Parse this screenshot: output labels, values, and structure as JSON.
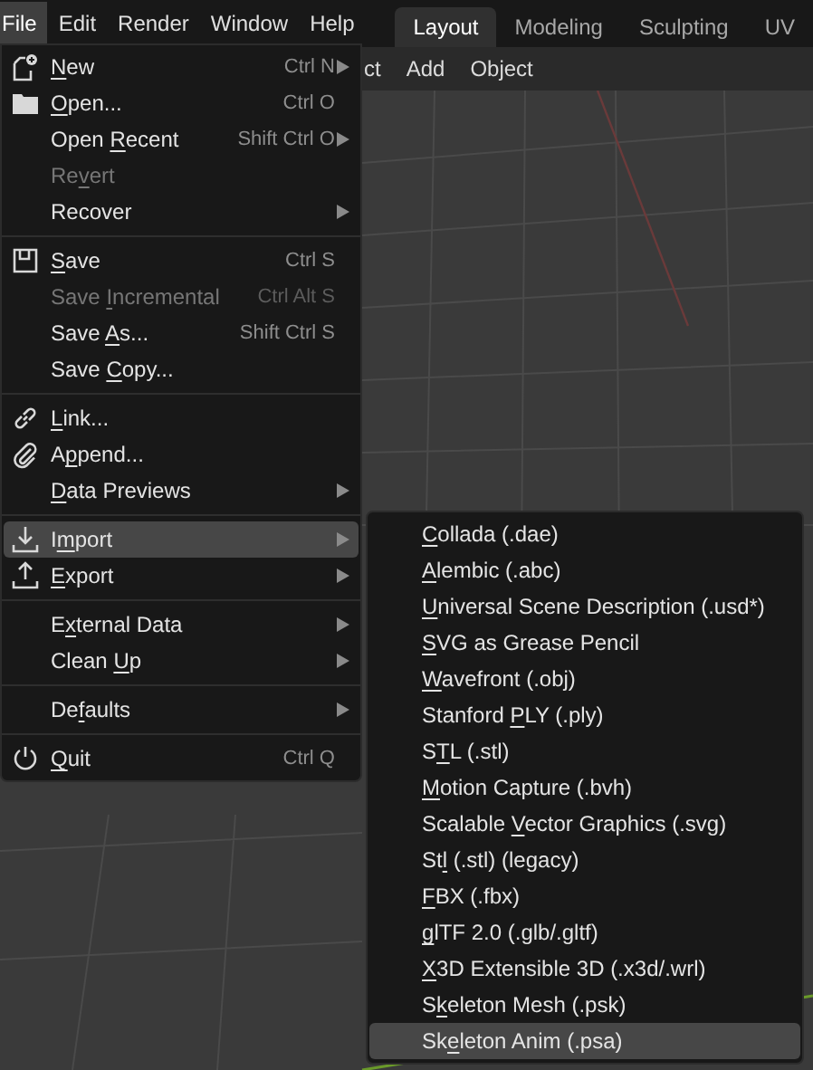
{
  "menubar": {
    "menus": [
      {
        "label": "File",
        "selected": true
      },
      {
        "label": "Edit",
        "selected": false
      },
      {
        "label": "Render",
        "selected": false
      },
      {
        "label": "Window",
        "selected": false
      },
      {
        "label": "Help",
        "selected": false
      }
    ],
    "workspaces": [
      {
        "label": "Layout",
        "selected": true
      },
      {
        "label": "Modeling",
        "selected": false
      },
      {
        "label": "Sculpting",
        "selected": false
      },
      {
        "label": "UV",
        "selected": false
      }
    ]
  },
  "viewport_header": {
    "items": [
      "ct",
      "Add",
      "Object"
    ]
  },
  "file_menu": {
    "sections": [
      [
        {
          "key": "N",
          "post": "ew",
          "shortcut": "Ctrl N",
          "submenu": true,
          "disabled": false,
          "selected": false
        },
        {
          "key": "O",
          "post": "pen...",
          "shortcut": "Ctrl O",
          "submenu": false,
          "disabled": false,
          "selected": false
        },
        {
          "pre": "Open ",
          "key": "R",
          "post": "ecent",
          "shortcut": "Shift Ctrl O",
          "submenu": true,
          "disabled": false,
          "selected": false
        },
        {
          "pre": "Re",
          "key": "v",
          "post": "ert",
          "submenu": false,
          "disabled": true,
          "selected": false
        },
        {
          "pre": "Recover",
          "submenu": true,
          "disabled": false,
          "selected": false
        }
      ],
      [
        {
          "key": "S",
          "post": "ave",
          "shortcut": "Ctrl S",
          "submenu": false,
          "disabled": false,
          "selected": false
        },
        {
          "pre": "Save ",
          "key": "I",
          "post": "ncremental",
          "shortcut": "Ctrl Alt S",
          "submenu": false,
          "disabled": true,
          "selected": false
        },
        {
          "pre": "Save ",
          "key": "A",
          "post": "s...",
          "shortcut": "Shift Ctrl S",
          "submenu": false,
          "disabled": false,
          "selected": false
        },
        {
          "pre": "Save ",
          "key": "C",
          "post": "opy...",
          "submenu": false,
          "disabled": false,
          "selected": false
        }
      ],
      [
        {
          "key": "L",
          "post": "ink...",
          "submenu": false,
          "disabled": false,
          "selected": false
        },
        {
          "pre": "A",
          "key": "p",
          "post": "pend...",
          "submenu": false,
          "disabled": false,
          "selected": false
        },
        {
          "key": "D",
          "post": "ata Previews",
          "submenu": true,
          "disabled": false,
          "selected": false
        }
      ],
      [
        {
          "pre": "I",
          "key": "m",
          "post": "port",
          "submenu": true,
          "disabled": false,
          "selected": true
        },
        {
          "key": "E",
          "post": "xport",
          "submenu": true,
          "disabled": false,
          "selected": false
        }
      ],
      [
        {
          "pre": "E",
          "key": "x",
          "post": "ternal Data",
          "submenu": true,
          "disabled": false,
          "selected": false
        },
        {
          "pre": "Clean ",
          "key": "U",
          "post": "p",
          "submenu": true,
          "disabled": false,
          "selected": false
        }
      ],
      [
        {
          "pre": "De",
          "key": "f",
          "post": "aults",
          "submenu": true,
          "disabled": false,
          "selected": false
        }
      ],
      [
        {
          "key": "Q",
          "post": "uit",
          "shortcut": "Ctrl Q",
          "submenu": false,
          "disabled": false,
          "selected": false
        }
      ]
    ]
  },
  "import_menu": {
    "items": [
      {
        "key": "C",
        "post": "ollada (.dae)",
        "selected": false
      },
      {
        "key": "A",
        "post": "lembic (.abc)",
        "selected": false
      },
      {
        "key": "U",
        "post": "niversal Scene Description (.usd*)",
        "selected": false
      },
      {
        "key": "S",
        "post": "VG as Grease Pencil",
        "selected": false
      },
      {
        "key": "W",
        "post": "avefront (.obj)",
        "selected": false
      },
      {
        "pre": "Stanford ",
        "key": "P",
        "post": "LY (.ply)",
        "selected": false
      },
      {
        "pre": "S",
        "key": "T",
        "post": "L (.stl)",
        "selected": false
      },
      {
        "key": "M",
        "post": "otion Capture (.bvh)",
        "selected": false
      },
      {
        "pre": "Scalable ",
        "key": "V",
        "post": "ector Graphics (.svg)",
        "selected": false
      },
      {
        "pre": "St",
        "key": "l",
        "post": " (.stl) (legacy)",
        "selected": false
      },
      {
        "key": "F",
        "post": "BX (.fbx)",
        "selected": false
      },
      {
        "key": "g",
        "post": "lTF 2.0 (.glb/.gltf)",
        "selected": false
      },
      {
        "key": "X",
        "post": "3D Extensible 3D (.x3d/.wrl)",
        "selected": false
      },
      {
        "pre": "S",
        "key": "k",
        "post": "eleton Mesh (.psk)",
        "selected": false
      },
      {
        "pre": "Sk",
        "key": "e",
        "post": "leton Anim (.psa)",
        "selected": true
      }
    ]
  }
}
